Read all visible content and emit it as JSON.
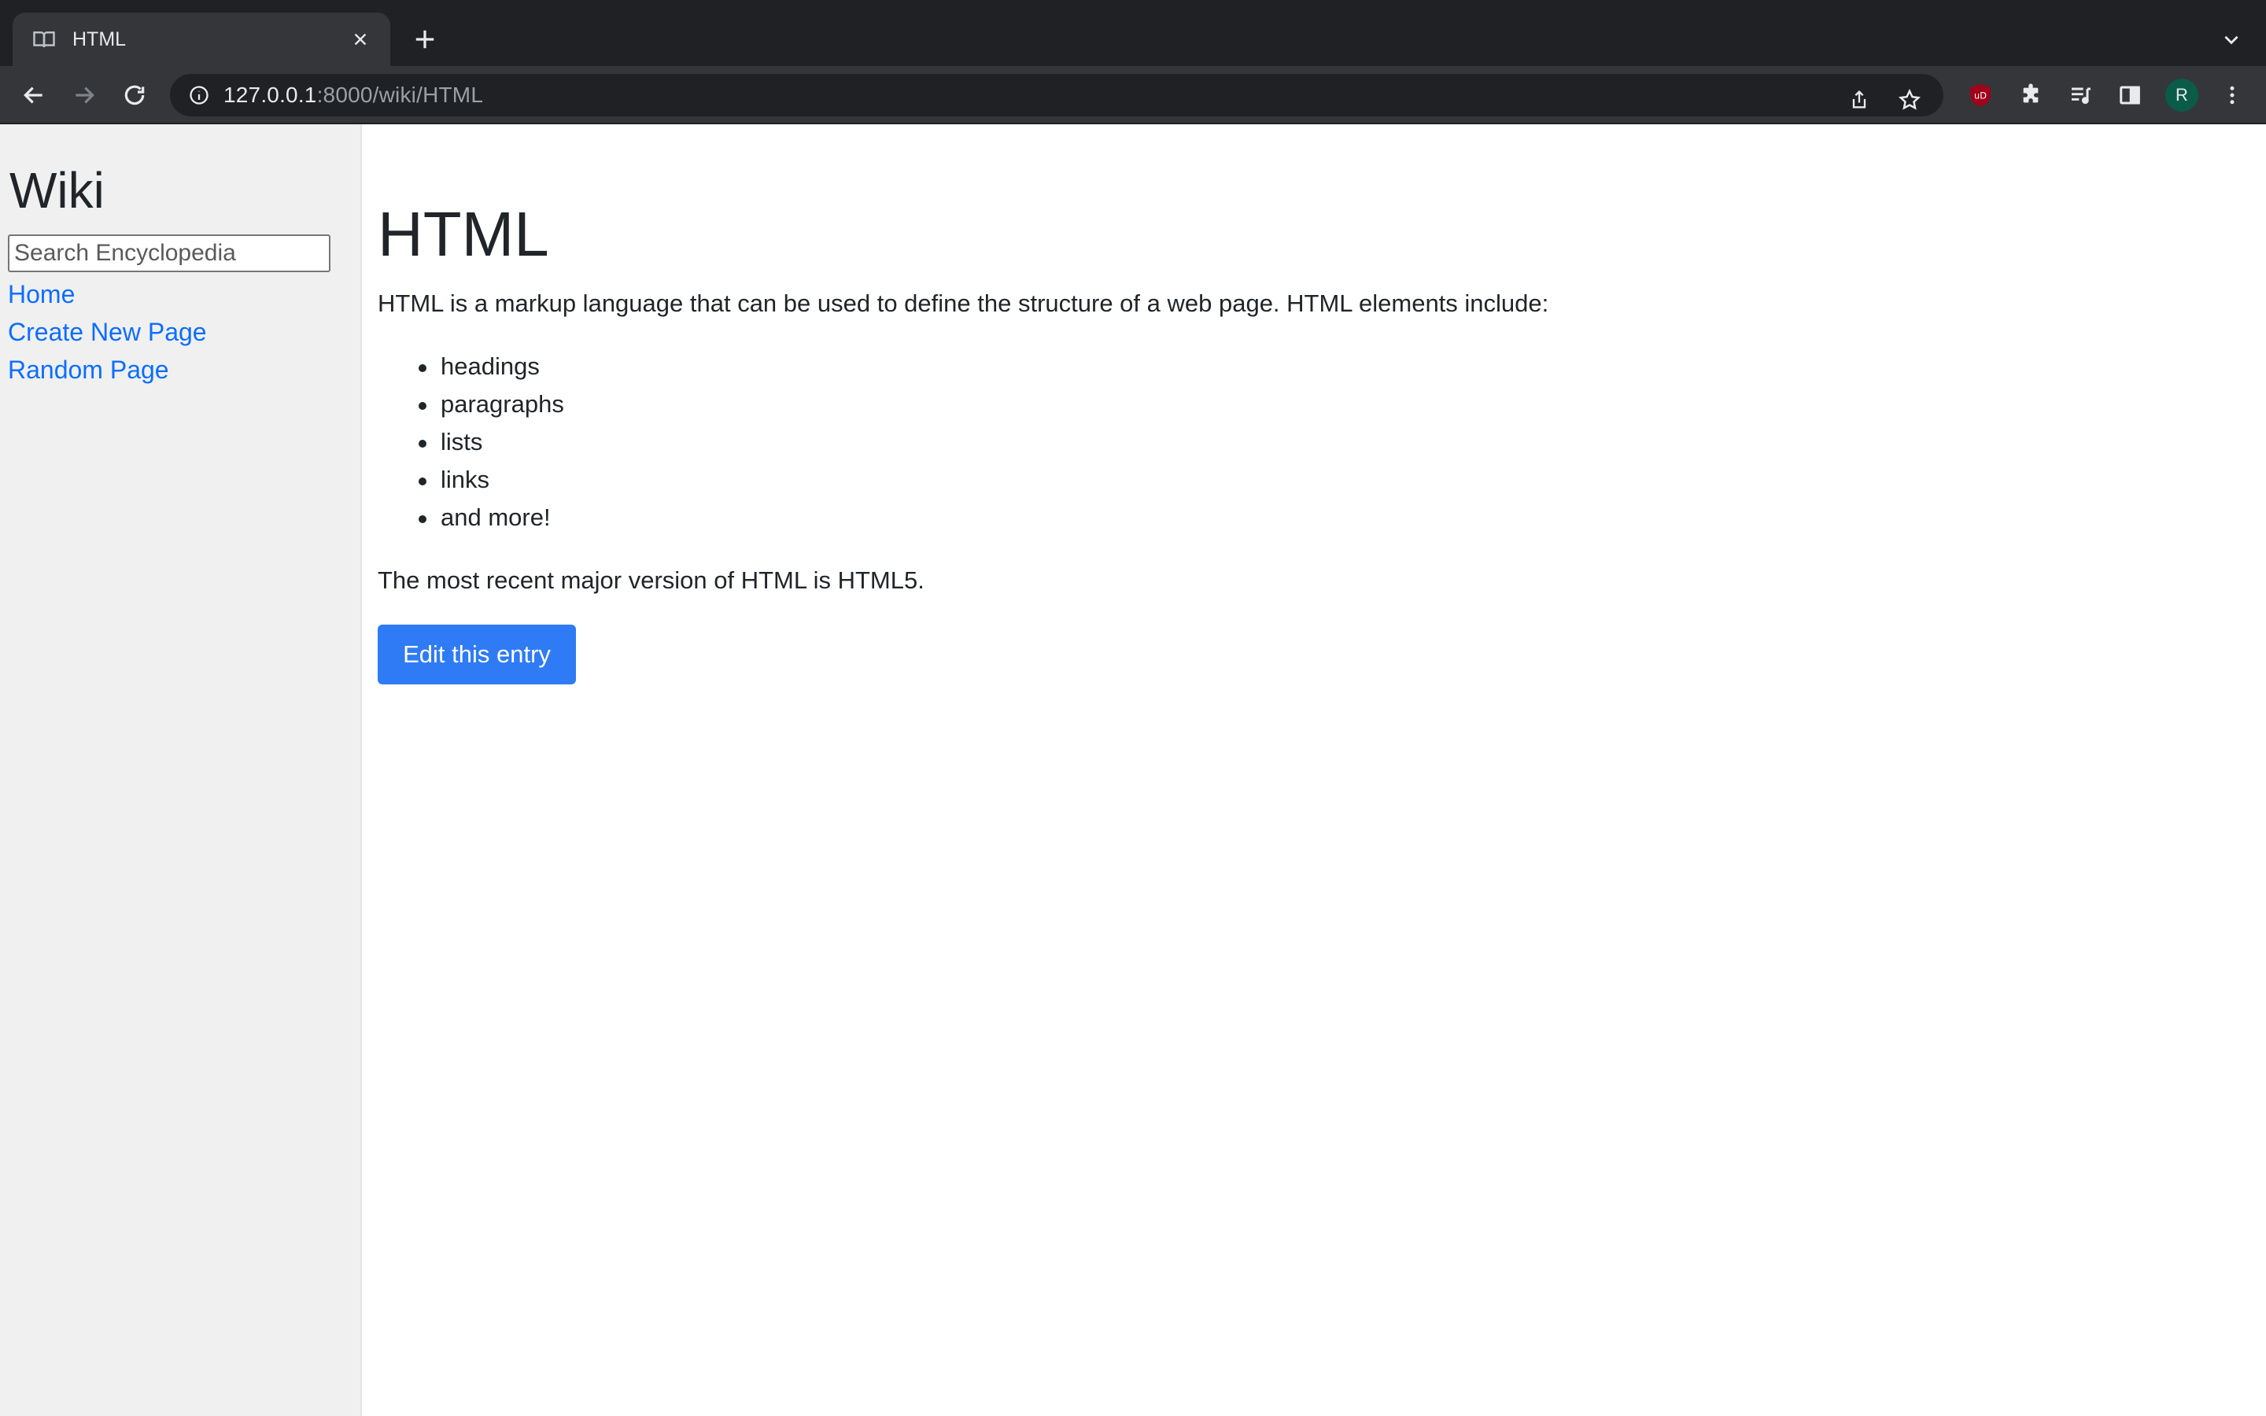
{
  "browser": {
    "tab_title": "HTML",
    "url_host": "127.0.0.1",
    "url_rest": ":8000/wiki/HTML",
    "profile_initial": "R",
    "extension_badge": "uD",
    "colors": {
      "chrome_dark": "#202124",
      "chrome_toolbar": "#35363a",
      "avatar_bg": "#0b5b49",
      "ublock_red": "#a3001a"
    }
  },
  "sidebar": {
    "title": "Wiki",
    "search_placeholder": "Search Encyclopedia",
    "links": [
      "Home",
      "Create New Page",
      "Random Page"
    ]
  },
  "article": {
    "title": "HTML",
    "intro": "HTML is a markup language that can be used to define the structure of a web page. HTML elements include:",
    "list_items": [
      "headings",
      "paragraphs",
      "lists",
      "links",
      "and more!"
    ],
    "outro": "The most recent major version of HTML is HTML5.",
    "edit_button_label": "Edit this entry"
  },
  "colors": {
    "link": "#0d6efd",
    "button_bg": "#2f7bf5",
    "sidebar_bg": "#f0f0f0",
    "text": "#212529"
  }
}
